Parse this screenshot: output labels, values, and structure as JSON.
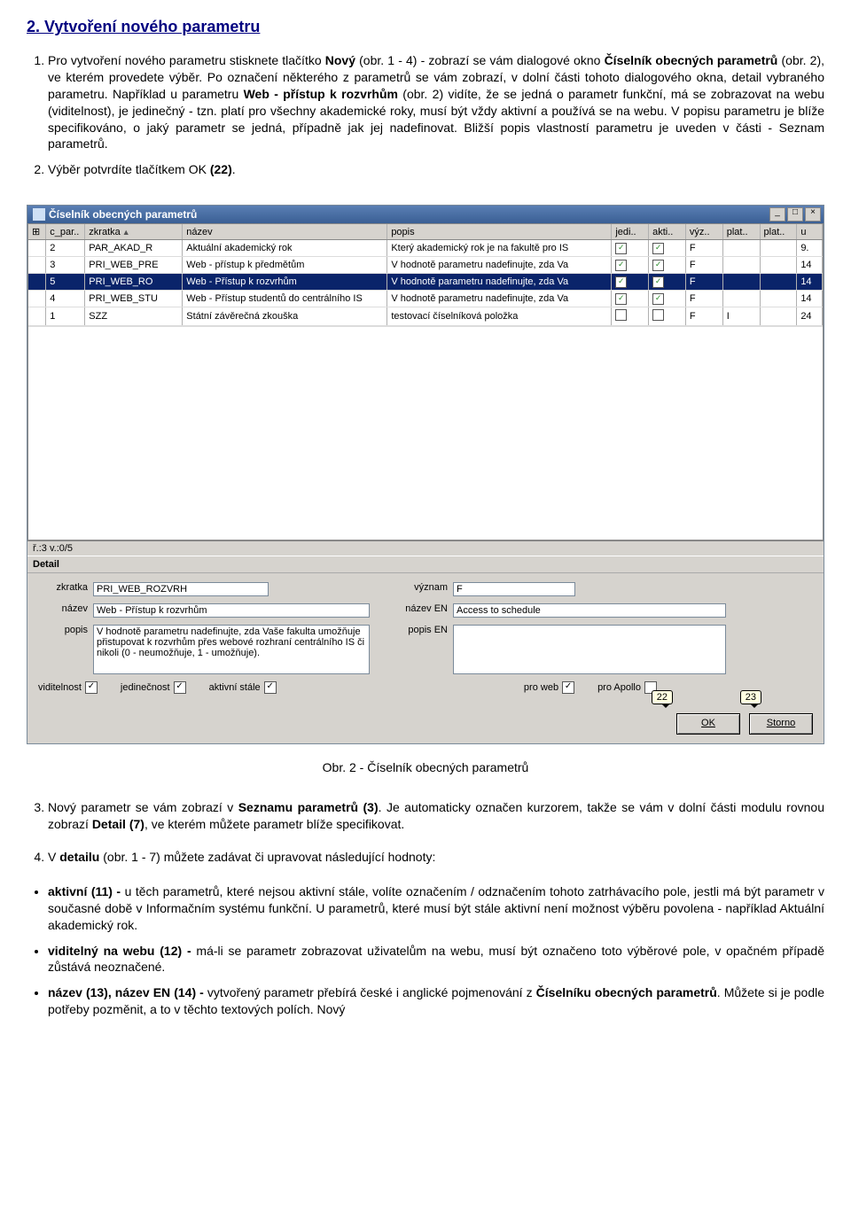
{
  "section_title": "2. Vytvoření nového parametru",
  "para1": {
    "t1": "Pro vytvoření nového parametru stisknete tlačítko ",
    "b1": "Nový",
    "t2": " (obr. 1 - 4) - zobrazí se vám dialogové okno ",
    "b2": "Číselník obecných parametrů",
    "t3": " (obr. 2), ve kterém provedete výběr. Po označení některého z parametrů se vám zobrazí, v dolní části tohoto dialogového okna, detail vybraného parametru. Například u parametru ",
    "b3": "Web - přístup k rozvrhům",
    "t4": " (obr. 2) vidíte, že se jedná o parametr funkční, má se zobrazovat na webu (viditelnost), je jedinečný - tzn. platí pro všechny akademické roky, musí být vždy aktivní a používá se na webu. V popisu parametru je blíže specifikováno, o jaký parametr se jedná, případně jak jej nadefinovat. Bližší popis vlastností parametru je uveden v části - Seznam parametrů."
  },
  "para2": {
    "t1": "Výběr potvrdíte tlačítkem OK ",
    "b1": "(22)",
    "t2": "."
  },
  "window": {
    "title": "Číselník obecných parametrů",
    "win_min": "_",
    "win_max": "□",
    "win_close": "×",
    "cols": {
      "c0": "⊞",
      "c1": "c_par..",
      "c2": "zkratka",
      "c3": "název",
      "c4": "popis",
      "c5": "jedi..",
      "c6": "akti..",
      "c7": "výz..",
      "c8": "plat..",
      "c9": "plat..",
      "c10": "u"
    },
    "rows": [
      {
        "c1": "2",
        "c2": "PAR_AKAD_R",
        "c3": "Aktuální akademický rok",
        "c4": "Který akademický rok je na fakultě pro IS",
        "c5": "✓",
        "c6": "✓",
        "c7": "F",
        "c8": "",
        "c9": "",
        "c10": "9."
      },
      {
        "c1": "3",
        "c2": "PRI_WEB_PRE",
        "c3": "Web - přístup k předmětům",
        "c4": "V hodnotě parametru nadefinujte, zda Va",
        "c5": "✓",
        "c6": "✓",
        "c7": "F",
        "c8": "",
        "c9": "",
        "c10": "14"
      },
      {
        "c1": "5",
        "c2": "PRI_WEB_RO",
        "c3": "Web - Přístup k rozvrhům",
        "c4": "V hodnotě parametru nadefinujte, zda Va",
        "c5": "✓",
        "c6": "✓",
        "c7": "F",
        "c8": "",
        "c9": "",
        "c10": "14"
      },
      {
        "c1": "4",
        "c2": "PRI_WEB_STU",
        "c3": "Web - Přístup studentů do centrálního IS",
        "c4": "V hodnotě parametru nadefinujte, zda Va",
        "c5": "✓",
        "c6": "✓",
        "c7": "F",
        "c8": "",
        "c9": "",
        "c10": "14"
      },
      {
        "c1": "1",
        "c2": "SZZ",
        "c3": "Státní závěrečná zkouška",
        "c4": "testovací číselníková položka",
        "c5": "",
        "c6": "",
        "c7": "F",
        "c8": "I",
        "c9": "",
        "c10": "24"
      }
    ],
    "status_left": "ř.:3 v.:0/5",
    "status_right": "",
    "detail_label": "Detail",
    "fields": {
      "zkratka_lbl": "zkratka",
      "zkratka_val": "PRI_WEB_ROZVRH",
      "vyznam_lbl": "význam",
      "vyznam_val": "F",
      "nazev_lbl": "název",
      "nazev_val": "Web - Přístup k rozvrhům",
      "nazev_en_lbl": "název EN",
      "nazev_en_val": "Access to schedule",
      "popis_lbl": "popis",
      "popis_val": "V hodnotě parametru nadefinujte, zda Vaše fakulta umožňuje přistupovat k rozvrhům přes webové rozhraní centrálního IS či nikoli (0 - neumožňuje, 1 - umožňuje).",
      "popis_en_lbl": "popis EN",
      "popis_en_val": "",
      "viditelnost_lbl": "viditelnost",
      "jedinecnost_lbl": "jedinečnost",
      "aktivni_lbl": "aktivní stále",
      "proweb_lbl": "pro web",
      "proapollo_lbl": "pro Apollo"
    },
    "callout_22": "22",
    "callout_23": "23",
    "ok_label": "OK",
    "storno_label": "Storno"
  },
  "caption": "Obr. 2 - Číselník obecných parametrů",
  "para3": {
    "t1": "Nový parametr se vám zobrazí v ",
    "b1": "Seznamu parametrů (3)",
    "t2": ". Je automaticky označen kurzorem, takže se vám v dolní části modulu rovnou zobrazí ",
    "b2": "Detail (7)",
    "t3": ", ve kterém můžete parametr blíže specifikovat."
  },
  "para4": {
    "t1": "V ",
    "b1": "detailu",
    "t2": " (obr. 1 - 7) můžete zadávat či upravovat následující hodnoty:"
  },
  "bullets": {
    "b1": {
      "bold": "aktivní (11) - ",
      "text": "u těch parametrů, které nejsou aktivní stále, volíte označením / odznačením tohoto zatrhávacího pole, jestli má být parametr v současné době v Informačním systému funkční. U parametrů, které musí být stále aktivní není možnost výběru povolena - například Aktuální akademický rok."
    },
    "b2": {
      "bold": "viditelný na webu (12) - ",
      "text": "má-li se parametr zobrazovat uživatelům na webu, musí být označeno toto výběrové pole, v opačném případě zůstává neoznačené."
    },
    "b3": {
      "bold1": "název (13), název EN (14) - ",
      "text1": "vytvořený parametr přebírá české i anglické pojmenování z ",
      "bold2": "Číselníku obecných parametrů",
      "text2": ". Můžete si je podle potřeby pozměnit, a to v těchto textových polích. Nový"
    }
  }
}
